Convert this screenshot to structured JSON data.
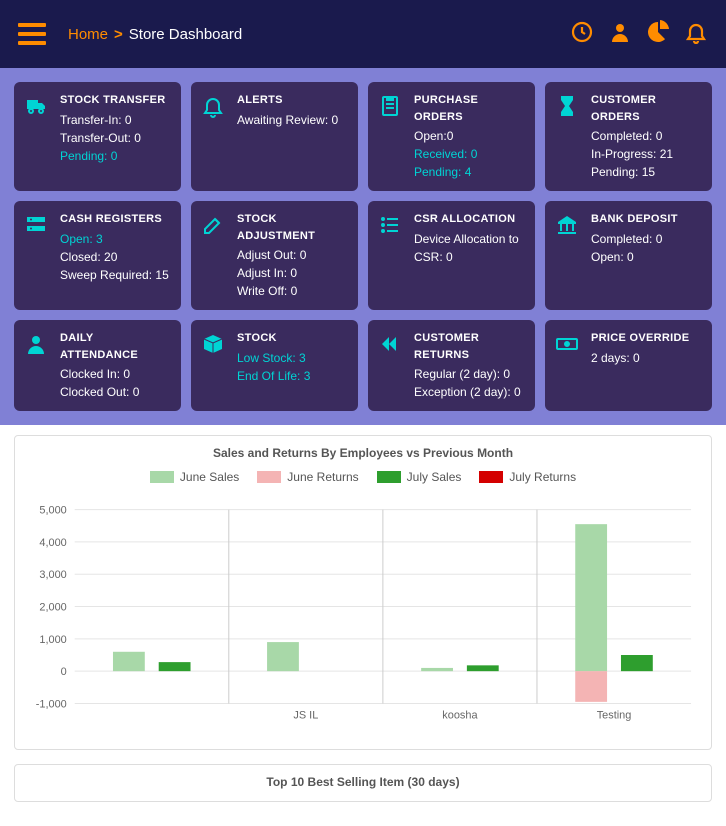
{
  "header": {
    "home": "Home",
    "sep": ">",
    "title": "Store Dashboard"
  },
  "colors": {
    "cyan": "#00d4d4",
    "orange": "#ff8c00"
  },
  "cards": [
    {
      "icon": "truck-icon",
      "title": "STOCK TRANSFER",
      "lines": [
        {
          "label": "Transfer-In: ",
          "value": "0",
          "cyan": false
        },
        {
          "label": "Transfer-Out: ",
          "value": "0",
          "cyan": false
        },
        {
          "label": "Pending: ",
          "value": "0",
          "cyan": true
        }
      ]
    },
    {
      "icon": "bell-icon",
      "title": "ALERTS",
      "lines": [
        {
          "label": "Awaiting Review: ",
          "value": "0",
          "cyan": false
        }
      ]
    },
    {
      "icon": "clipboard-icon",
      "title": "PURCHASE ORDERS",
      "lines": [
        {
          "label": "Open:",
          "value": "0",
          "cyan": false
        },
        {
          "label": "Received: ",
          "value": "0",
          "cyan": true
        },
        {
          "label": "Pending: ",
          "value": "4",
          "cyan": true
        }
      ]
    },
    {
      "icon": "hourglass-icon",
      "title": "CUSTOMER ORDERS",
      "lines": [
        {
          "label": "Completed: ",
          "value": "0",
          "cyan": false
        },
        {
          "label": "In-Progress: ",
          "value": "21",
          "cyan": false
        },
        {
          "label": "Pending: ",
          "value": "15",
          "cyan": false
        }
      ]
    },
    {
      "icon": "register-icon",
      "title": "CASH REGISTERS",
      "lines": [
        {
          "label": "Open: ",
          "value": "3",
          "cyan": true
        },
        {
          "label": "Closed: ",
          "value": "20",
          "cyan": false
        },
        {
          "label": "Sweep Required: ",
          "value": "15",
          "cyan": false
        }
      ]
    },
    {
      "icon": "edit-icon",
      "title": "STOCK ADJUSTMENT",
      "lines": [
        {
          "label": "Adjust Out: ",
          "value": "0",
          "cyan": false
        },
        {
          "label": "Adjust In: ",
          "value": "0",
          "cyan": false
        },
        {
          "label": "Write Off: ",
          "value": "0",
          "cyan": false
        }
      ]
    },
    {
      "icon": "list-icon",
      "title": "CSR ALLOCATION",
      "lines": [
        {
          "label": "Device Allocation to CSR: ",
          "value": "0",
          "cyan": false
        }
      ]
    },
    {
      "icon": "bank-icon",
      "title": "BANK DEPOSIT",
      "lines": [
        {
          "label": "Completed: ",
          "value": "0",
          "cyan": false
        },
        {
          "label": "Open: ",
          "value": "0",
          "cyan": false
        }
      ]
    },
    {
      "icon": "person-icon",
      "title": "DAILY ATTENDANCE",
      "lines": [
        {
          "label": "Clocked In: ",
          "value": "0",
          "cyan": false
        },
        {
          "label": "Clocked Out: ",
          "value": "0",
          "cyan": false
        }
      ]
    },
    {
      "icon": "box-icon",
      "title": "STOCK",
      "lines": [
        {
          "label": "Low Stock: ",
          "value": "3",
          "cyan": true
        },
        {
          "label": "End Of Life: ",
          "value": "3",
          "cyan": true
        }
      ]
    },
    {
      "icon": "return-icon",
      "title": "CUSTOMER RETURNS",
      "lines": [
        {
          "label": "Regular (2 day): ",
          "value": "0",
          "cyan": false
        },
        {
          "label": "Exception (2 day): ",
          "value": "0",
          "cyan": false
        }
      ]
    },
    {
      "icon": "money-icon",
      "title": "PRICE OVERRIDE",
      "lines": [
        {
          "label": "2 days: ",
          "value": "0",
          "cyan": false
        }
      ]
    }
  ],
  "chart1": {
    "title": "Sales and Returns By Employees vs Previous Month",
    "legend": [
      {
        "name": "June Sales",
        "color": "#a8d8a8"
      },
      {
        "name": "June Returns",
        "color": "#f4b4b4"
      },
      {
        "name": "July Sales",
        "color": "#2e9e2e"
      },
      {
        "name": "July Returns",
        "color": "#d40000"
      }
    ]
  },
  "chart2": {
    "title": "Top 10 Best Selling Item (30 days)"
  },
  "chart_data": {
    "type": "bar",
    "title": "Sales and Returns By Employees vs Previous Month",
    "xlabel": "",
    "ylabel": "",
    "ylim": [
      -1000,
      5000
    ],
    "yticks": [
      -1000,
      0,
      1000,
      2000,
      3000,
      4000,
      5000
    ],
    "categories": [
      "",
      "JS IL",
      "koosha",
      "Testing"
    ],
    "series": [
      {
        "name": "June Sales",
        "color": "#a8d8a8",
        "values": [
          600,
          900,
          100,
          4550
        ]
      },
      {
        "name": "June Returns",
        "color": "#f4b4b4",
        "values": [
          0,
          0,
          0,
          -950
        ]
      },
      {
        "name": "July Sales",
        "color": "#2e9e2e",
        "values": [
          280,
          0,
          180,
          500
        ]
      },
      {
        "name": "July Returns",
        "color": "#d40000",
        "values": [
          0,
          0,
          0,
          0
        ]
      }
    ]
  }
}
